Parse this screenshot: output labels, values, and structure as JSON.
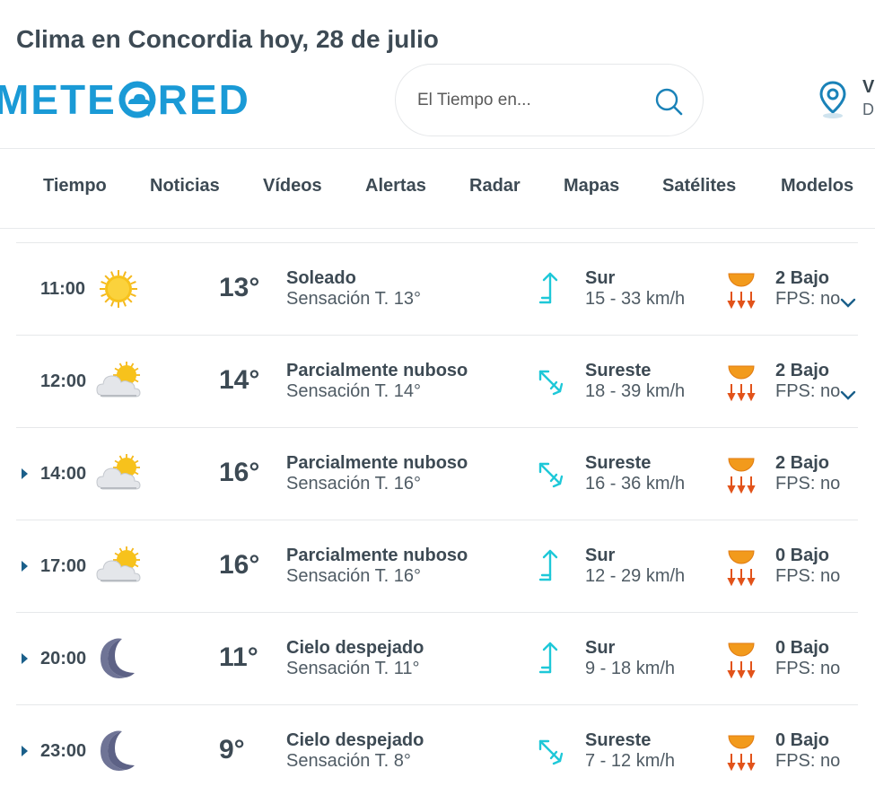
{
  "page": {
    "title": "Clima en Concordia hoy, 28 de julio"
  },
  "header": {
    "logo_text": "METEORED",
    "logo_parts": {
      "left": "METE",
      "right": "RED"
    },
    "search_placeholder": "El Tiempo en...",
    "location_title": "V",
    "location_sub": "D"
  },
  "nav": {
    "items": [
      "Tiempo",
      "Noticias",
      "Vídeos",
      "Alertas",
      "Radar",
      "Mapas",
      "Satélites",
      "Modelos"
    ]
  },
  "colors": {
    "accent": "#1a9ad6",
    "text": "#3d4a54",
    "wind_icon": "#1ec8d8",
    "uv_icon": "#f29a1c"
  },
  "hours": [
    {
      "time": "11:00",
      "icon": "sun-icon",
      "temp": "13°",
      "condition": "Soleado",
      "feels": "Sensación T. 13°",
      "wind_dir": "Sur",
      "wind_icon": "wind-north-arrow-icon",
      "wind_speed": "15 - 33 km/h",
      "uv": "2 Bajo",
      "fps": "FPS: no",
      "expandable": false,
      "chevron": true
    },
    {
      "time": "12:00",
      "icon": "partly-cloudy-icon",
      "temp": "14°",
      "condition": "Parcialmente nuboso",
      "feels": "Sensación T. 14°",
      "wind_dir": "Sureste",
      "wind_icon": "wind-northwest-arrow-icon",
      "wind_speed": "18 - 39 km/h",
      "uv": "2 Bajo",
      "fps": "FPS: no",
      "expandable": false,
      "chevron": true
    },
    {
      "time": "14:00",
      "icon": "partly-cloudy-icon",
      "temp": "16°",
      "condition": "Parcialmente nuboso",
      "feels": "Sensación T. 16°",
      "wind_dir": "Sureste",
      "wind_icon": "wind-northwest-arrow-icon",
      "wind_speed": "16 - 36 km/h",
      "uv": "2 Bajo",
      "fps": "FPS: no",
      "expandable": true,
      "chevron": false
    },
    {
      "time": "17:00",
      "icon": "partly-cloudy-icon",
      "temp": "16°",
      "condition": "Parcialmente nuboso",
      "feels": "Sensación T. 16°",
      "wind_dir": "Sur",
      "wind_icon": "wind-north-arrow-icon",
      "wind_speed": "12 - 29 km/h",
      "uv": "0 Bajo",
      "fps": "FPS: no",
      "expandable": true,
      "chevron": false
    },
    {
      "time": "20:00",
      "icon": "moon-icon",
      "temp": "11°",
      "condition": "Cielo despejado",
      "feels": "Sensación T. 11°",
      "wind_dir": "Sur",
      "wind_icon": "wind-north-arrow-icon",
      "wind_speed": "9 - 18 km/h",
      "uv": "0 Bajo",
      "fps": "FPS: no",
      "expandable": true,
      "chevron": false
    },
    {
      "time": "23:00",
      "icon": "moon-icon",
      "temp": "9°",
      "condition": "Cielo despejado",
      "feels": "Sensación T. 8°",
      "wind_dir": "Sureste",
      "wind_icon": "wind-northwest-arrow-icon",
      "wind_speed": "7 - 12 km/h",
      "uv": "0 Bajo",
      "fps": "FPS: no",
      "expandable": true,
      "chevron": false
    }
  ]
}
